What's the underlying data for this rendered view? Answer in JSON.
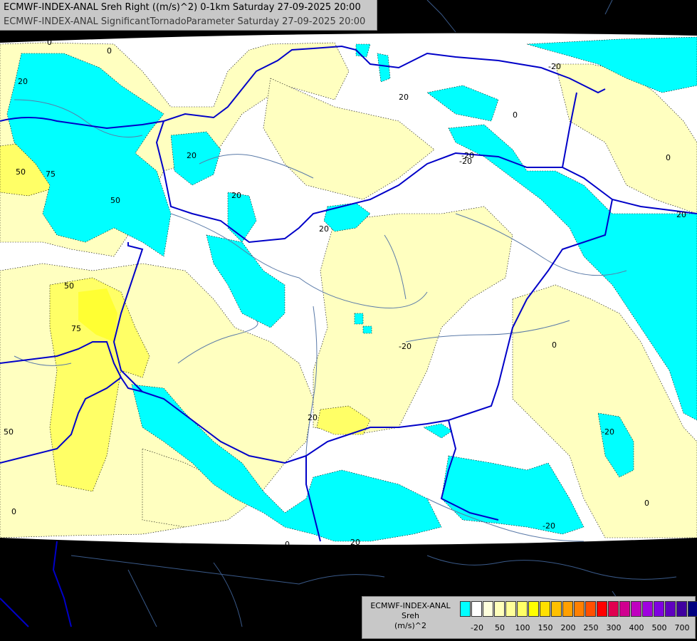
{
  "header": {
    "line1": "ECMWF-INDEX-ANAL Sreh Right ((m/s)^2) 0-1km Saturday 27-09-2025 20:00",
    "line2": "ECMWF-INDEX-ANAL SignificantTornadoParameter Saturday 27-09-2025 20:00"
  },
  "legend": {
    "line1": "ECMWF-INDEX-ANAL",
    "line2": "Sreh",
    "line3": "(m/s)^2",
    "colors": [
      "#00ffff",
      "#ffffff",
      "#ffffdd",
      "#ffffbb",
      "#ffff99",
      "#ffff66",
      "#ffff00",
      "#ffe000",
      "#ffc000",
      "#ffa000",
      "#ff8000",
      "#ff5000",
      "#ff0000",
      "#e00050",
      "#d00090",
      "#c000c0",
      "#a000e0",
      "#8000e0",
      "#6000c0",
      "#4000a0",
      "#000080"
    ],
    "ticks": [
      "-20",
      "50",
      "100",
      "150",
      "200",
      "250",
      "300",
      "400",
      "500",
      "700"
    ]
  },
  "contour_labels": [
    {
      "text": "0"
    },
    {
      "text": "0"
    },
    {
      "text": "20"
    },
    {
      "text": "50"
    },
    {
      "text": "75"
    },
    {
      "text": "50"
    },
    {
      "text": "20"
    },
    {
      "text": "20"
    },
    {
      "text": "20"
    },
    {
      "text": "20"
    },
    {
      "text": "-20"
    },
    {
      "text": "0"
    },
    {
      "text": "0"
    },
    {
      "text": "-20"
    },
    {
      "text": "20"
    },
    {
      "text": "-20"
    },
    {
      "text": "50"
    },
    {
      "text": "75"
    },
    {
      "text": "0"
    },
    {
      "text": "50"
    },
    {
      "text": "20"
    },
    {
      "text": "0"
    },
    {
      "text": "-20"
    },
    {
      "text": "20"
    },
    {
      "text": "0"
    },
    {
      "text": "-20"
    },
    {
      "text": "0"
    },
    {
      "text": "-20"
    }
  ]
}
